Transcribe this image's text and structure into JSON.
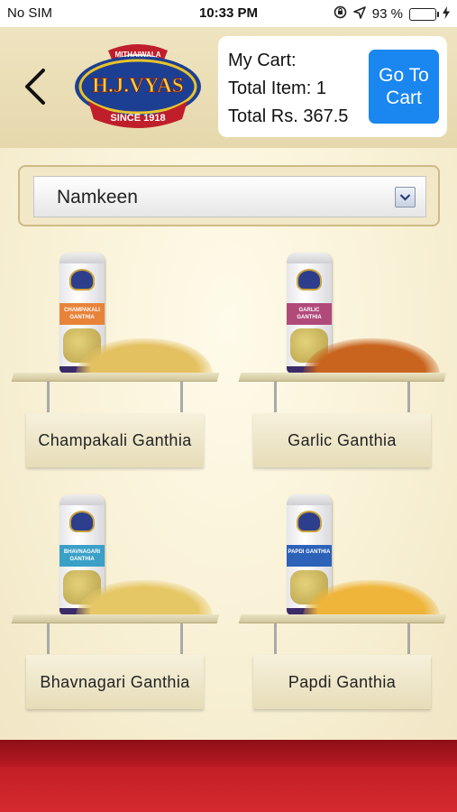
{
  "status_bar": {
    "carrier": "No SIM",
    "time": "10:33 PM",
    "battery": "93 %",
    "battery_level": 0.93
  },
  "header": {
    "logo": {
      "top_text": "MITHAIWALA",
      "brand": "H.J.VYAS",
      "since": "SINCE 1918"
    },
    "cart": {
      "title": "My Cart:",
      "total_items": "Total Item: 1",
      "total_amount": "Total Rs. 367.5",
      "go_to_cart_line1": "Go To",
      "go_to_cart_line2": "Cart"
    }
  },
  "category_select": {
    "selected": "Namkeen"
  },
  "products": [
    {
      "name": "Champakali Ganthia",
      "jar_label": "CHAMPAKALI GANTHIA",
      "label_color": "#e8833a",
      "snack_color": "#e3c060"
    },
    {
      "name": "Garlic Ganthia",
      "jar_label": "GARLIC GANTHIA",
      "label_color": "#b04a7a",
      "snack_color": "#c8641e"
    },
    {
      "name": "Bhavnagari Ganthia",
      "jar_label": "BHAVNAGARI GANTHIA",
      "label_color": "#3aa0c8",
      "snack_color": "#e6c766"
    },
    {
      "name": "Papdi Ganthia",
      "jar_label": "PAPDI GANTHIA",
      "label_color": "#2c62b8",
      "snack_color": "#eeb53a"
    }
  ],
  "colors": {
    "accent": "#1a86f0",
    "footer": "#c21d25"
  }
}
